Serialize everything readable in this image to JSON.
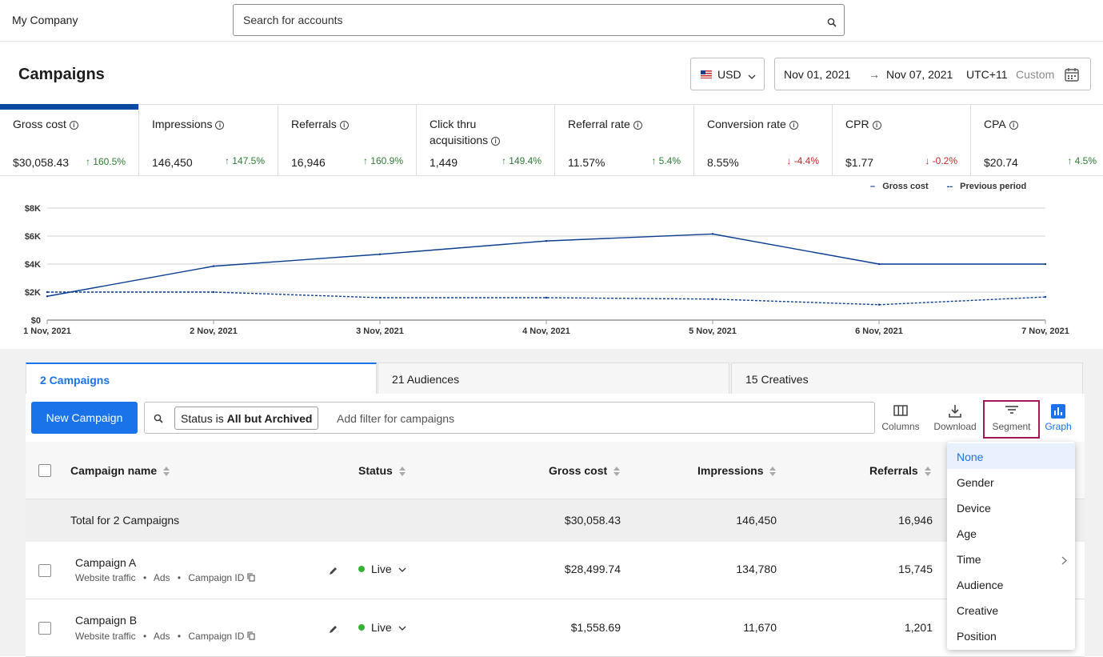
{
  "topbar": {
    "company": "My Company",
    "search_placeholder": "Search for accounts"
  },
  "header": {
    "title": "Campaigns",
    "currency": "USD",
    "date_start": "Nov 01, 2021",
    "date_arrow": "→",
    "date_end": "Nov 07, 2021",
    "timezone": "UTC+11",
    "range_type": "Custom"
  },
  "metrics": [
    {
      "name": "Gross cost",
      "value": "$30,058.43",
      "change": "↑ 160.5%",
      "dir": "up"
    },
    {
      "name": "Impressions",
      "value": "146,450",
      "change": "↑ 147.5%",
      "dir": "up"
    },
    {
      "name": "Referrals",
      "value": "16,946",
      "change": "↑ 160.9%",
      "dir": "up"
    },
    {
      "name": "Click thru acquisitions",
      "value": "1,449",
      "change": "↑ 149.4%",
      "dir": "up"
    },
    {
      "name": "Referral rate",
      "value": "11.57%",
      "change": "↑ 5.4%",
      "dir": "up"
    },
    {
      "name": "Conversion rate",
      "value": "8.55%",
      "change": "↓ -4.4%",
      "dir": "down"
    },
    {
      "name": "CPR",
      "value": "$1.77",
      "change": "↓ -0.2%",
      "dir": "down"
    },
    {
      "name": "CPA",
      "value": "$20.74",
      "change": "↑ 4.5%",
      "dir": "up"
    }
  ],
  "chart_data": {
    "type": "line",
    "x": [
      "1 Nov, 2021",
      "2 Nov, 2021",
      "3 Nov, 2021",
      "4 Nov, 2021",
      "5 Nov, 2021",
      "6 Nov, 2021",
      "7 Nov, 2021"
    ],
    "series": [
      {
        "name": "Gross cost",
        "values": [
          1700,
          3850,
          4700,
          5650,
          6150,
          4000,
          4000
        ],
        "style": "solid",
        "color": "#0b3d91"
      },
      {
        "name": "Previous period",
        "values": [
          2000,
          2000,
          1600,
          1600,
          1500,
          1100,
          1650
        ],
        "style": "dashed",
        "color": "#0b3d91"
      }
    ],
    "y_ticks": [
      "$0",
      "$2K",
      "$4K",
      "$6K",
      "$8K"
    ],
    "ylim": [
      0,
      8000
    ],
    "grid": true,
    "legend_position": "top-right"
  },
  "tabs": [
    "2 Campaigns",
    "21 Audiences",
    "15 Creatives"
  ],
  "toolbar": {
    "new_campaign": "New Campaign",
    "filter_prefix": "Status is ",
    "filter_value": "All but Archived",
    "filter_placeholder": "Add filter for campaigns",
    "columns": "Columns",
    "download": "Download",
    "segment": "Segment",
    "graph": "Graph"
  },
  "table": {
    "headers": {
      "name": "Campaign name",
      "status": "Status",
      "gross": "Gross cost",
      "impressions": "Impressions",
      "referrals": "Referrals"
    },
    "total": {
      "label": "Total for 2 Campaigns",
      "gross": "$30,058.43",
      "impressions": "146,450",
      "referrals": "16,946"
    },
    "rows": [
      {
        "name": "Campaign A",
        "meta1": "Website traffic",
        "meta2": "Ads",
        "meta3": "Campaign ID",
        "status": "Live",
        "gross": "$28,499.74",
        "impressions": "134,780",
        "referrals": "15,745"
      },
      {
        "name": "Campaign B",
        "meta1": "Website traffic",
        "meta2": "Ads",
        "meta3": "Campaign ID",
        "status": "Live",
        "gross": "$1,558.69",
        "impressions": "11,670",
        "referrals": "1,201"
      }
    ]
  },
  "segment_menu": [
    "None",
    "Gender",
    "Device",
    "Age",
    "Time",
    "Audience",
    "Creative",
    "Position"
  ],
  "colors": {
    "accent": "#1a73e8",
    "chart_line": "#0b3d91",
    "positive": "#2e7d32",
    "negative": "#c62828",
    "live": "#34b233",
    "highlight": "#a0195a"
  }
}
